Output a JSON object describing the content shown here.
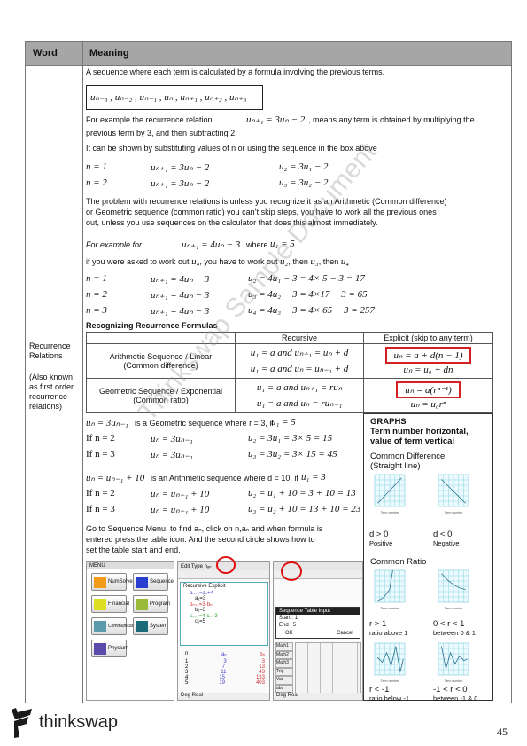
{
  "header": {
    "word": "Word",
    "meaning": "Meaning"
  },
  "word_cell": {
    "term": "Recurrence Relations",
    "note": "(Also known as first order recurrence relations)"
  },
  "intro": "A sequence where each term is calculated by a formula involving the previous terms.",
  "sequence_box": "uₙ₋₃ , uₙ₋₂ , uₙ₋₁ , uₙ , uₙ₊₁ , uₙ₊₂ , uₙ₊₃",
  "example1": {
    "pre": "For example the recurrence relation",
    "formula": "uₙ₊₁ = 3uₙ − 2",
    "post": ", means any term is obtained by multiplying the",
    "line2": "previous term by 3, and then subtracting 2."
  },
  "shown": "It can be shown by substituting values of n or using the sequence in the box above",
  "rows1": [
    [
      "n = 1",
      "uₙ₊₁ = 3uₙ − 2",
      "u₂ = 3u₁ − 2"
    ],
    [
      "n = 2",
      "uₙ₊₁ = 3uₙ − 2",
      "u₃ = 3u₂ − 2"
    ]
  ],
  "problem": [
    "The problem with recurrence relations is unless you recognize it as an Arithmetic (Common difference)",
    "or Geometric sequence (common ratio) you can’t skip steps, you have to work all the previous ones",
    "out, unless you use sequences on the calculator that does this almost immediately."
  ],
  "example2": {
    "pre": "For example for",
    "formula": "uₙ₊₁ = 4uₙ − 3",
    "where": "where",
    "cond": "u₁ = 5"
  },
  "asked": {
    "t1": "if you were asked to work out",
    "u4": "u₄",
    "t2": ", you have to work out",
    "u2": "u₂",
    "t3": ", then",
    "u3": "u₃",
    "t4": ", then",
    "u4b": "u₄"
  },
  "rows2": [
    [
      "n = 1",
      "uₙ₊₁ = 4uₙ − 3",
      "u₂ = 4u₁ − 3 = 4× 5 − 3 = 17"
    ],
    [
      "n = 2",
      "uₙ₊₁ = 4uₙ − 3",
      "u₃ = 4u₂ − 3 = 4×17 − 3 = 65"
    ],
    [
      "n = 3",
      "uₙ₊₁ = 4uₙ − 3",
      "u₄ = 4u₃ − 3 = 4× 65 − 3 = 257"
    ]
  ],
  "recognizing": {
    "title": "Recognizing Recurrence Formulas",
    "col_recursive": "Recursive",
    "col_explicit": "Explicit (skip to any term)",
    "arith": {
      "name": "Arithmetic Sequence / Linear",
      "sub": "(Common difference)",
      "r1": "u₁ = a  and  uₙ₊₁ = uₙ + d",
      "r2": "u₁ = a  and  uₙ = uₙ₋₁ + d",
      "e1": "uₙ = a + d(n − 1)",
      "e2": "uₙ = u₀ + dn"
    },
    "geo": {
      "name": "Geometric Sequence / Exponential",
      "sub": "(Common ratio)",
      "r1": "u₁ = a  and  uₙ₊₁ = ruₙ",
      "r2": "u₁ = a  and  uₙ = ruₙ₋₁",
      "e1": "uₙ = a(rⁿ⁻¹)",
      "e2": "uₙ = u₀rⁿ"
    }
  },
  "geo_example": {
    "formula": "uₙ = 3uₙ₋₁",
    "text": "is a Geometric sequence where r = 3, if",
    "cond": "u₁ = 5",
    "rows": [
      [
        "If  n = 2",
        "uₙ = 3uₙ₋₁",
        "u₂ = 3u₁ = 3× 5 = 15"
      ],
      [
        "If  n = 3",
        "uₙ = 3uₙ₋₁",
        "u₃ = 3u₂ = 3× 15 = 45"
      ]
    ]
  },
  "arith_example": {
    "formula": "uₙ = uₙ₋₁ + 10",
    "text": "is an Arithmetic sequence where d = 10, if",
    "cond": "u₁ = 3",
    "rows": [
      [
        "If  n = 2",
        "uₙ = uₙ₋₁ + 10",
        "u₂ = u₁ + 10 = 3 + 10 = 13"
      ],
      [
        "If  n = 3",
        "uₙ = uₙ₋₁ + 10",
        "u₃ = u₂ + 10 = 13 + 10 = 23"
      ]
    ]
  },
  "calc_instructions": [
    "Go to Sequence Menu, to find aₙ, click on n,aₙ and when formula is",
    "entered press the table icon. And the second circle shows how to",
    "set the table start and end."
  ],
  "calculator": {
    "menu_title": "MENU",
    "apps": [
      "NumSolve",
      "Sequence",
      "Financial",
      "Program",
      "Communication",
      "System",
      "Physium"
    ],
    "screen2": {
      "menubar": "Edit  Type  nₐₙ",
      "tabs": [
        "Recursive",
        "Explicit"
      ],
      "eqs": [
        "aₙ₊₁=aₙ+4",
        "a₁=3",
        "bₙ₊₁=3·bₙ",
        "b₁=3",
        "cₙ₊₁=4·cₙ−3",
        "c₁=5"
      ],
      "table_head": [
        "n",
        "aₙ",
        "bₙ"
      ],
      "table": [
        [
          "1",
          "3",
          "3"
        ],
        [
          "2",
          "7",
          "13"
        ],
        [
          "3",
          "11",
          "43"
        ],
        [
          "4",
          "15",
          "133"
        ],
        [
          "5",
          "19",
          "403"
        ]
      ],
      "status": "Deg  Real"
    },
    "screen3": {
      "dialog_title": "Sequence Table Input",
      "start_label": "Start :",
      "start": "1",
      "end_label": "End :",
      "end": "5",
      "ok": "OK",
      "cancel": "Cancel",
      "keys": [
        "Math1",
        "Math2",
        "Math3",
        "Trig",
        "Var",
        "abc"
      ],
      "status": "Deg  Real"
    }
  },
  "graphs": {
    "title": "GRAPHS",
    "subtitle": "Term number horizontal, value of term vertical",
    "cd_title": "Common Difference",
    "cd_sub": "(Straight line)",
    "cd": [
      {
        "cond": "d > 0",
        "label": "Positive"
      },
      {
        "cond": "d < 0",
        "label": "Negative"
      }
    ],
    "cr_title": "Common Ratio",
    "cr": [
      {
        "cond": "r > 1",
        "label": "ratio above 1"
      },
      {
        "cond": "0 < r < 1",
        "label": "between 0 & 1"
      },
      {
        "cond": "r < -1",
        "label": "ratio below -1"
      },
      {
        "cond": "-1 < r < 0",
        "label": "between -1 & 0"
      }
    ],
    "axis_x": "Term number",
    "axis_y": "Value of term",
    "grid_color": "#8fd3e0",
    "line_color": "#2a6f8a"
  },
  "watermark": "Thinkswap Sample Document",
  "footer": {
    "logo": "thinkswap",
    "page": "45"
  },
  "colors": {
    "header_bg": "#a6a6a6",
    "highlight": "#d42020"
  }
}
